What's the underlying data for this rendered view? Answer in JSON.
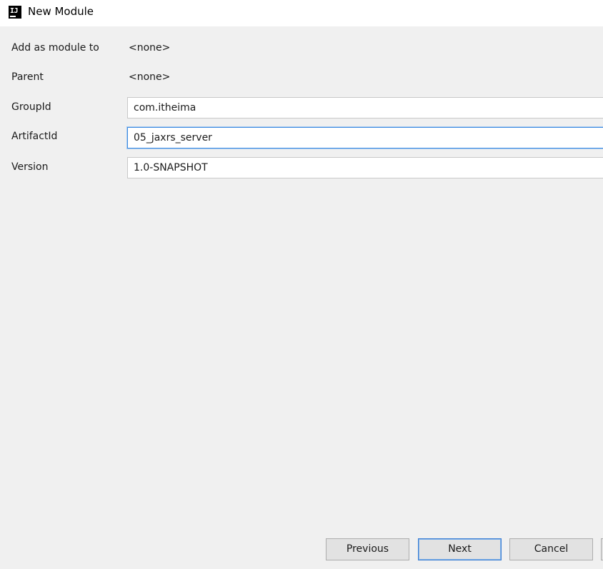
{
  "window": {
    "title": "New Module",
    "icon": "intellij-idea-icon",
    "icon_text": "IJ"
  },
  "form": {
    "add_as_module_to": {
      "label": "Add as module to",
      "value": "<none>"
    },
    "parent": {
      "label": "Parent",
      "value": "<none>"
    },
    "group_id": {
      "label": "GroupId",
      "value": "com.itheima"
    },
    "artifact_id": {
      "label": "ArtifactId",
      "value": "05_jaxrs_server"
    },
    "version": {
      "label": "Version",
      "value": "1.0-SNAPSHOT"
    }
  },
  "buttons": {
    "previous": "Previous",
    "next": "Next",
    "cancel": "Cancel"
  },
  "colors": {
    "background": "#f0f0f0",
    "focus_border": "#3d8ae0"
  }
}
